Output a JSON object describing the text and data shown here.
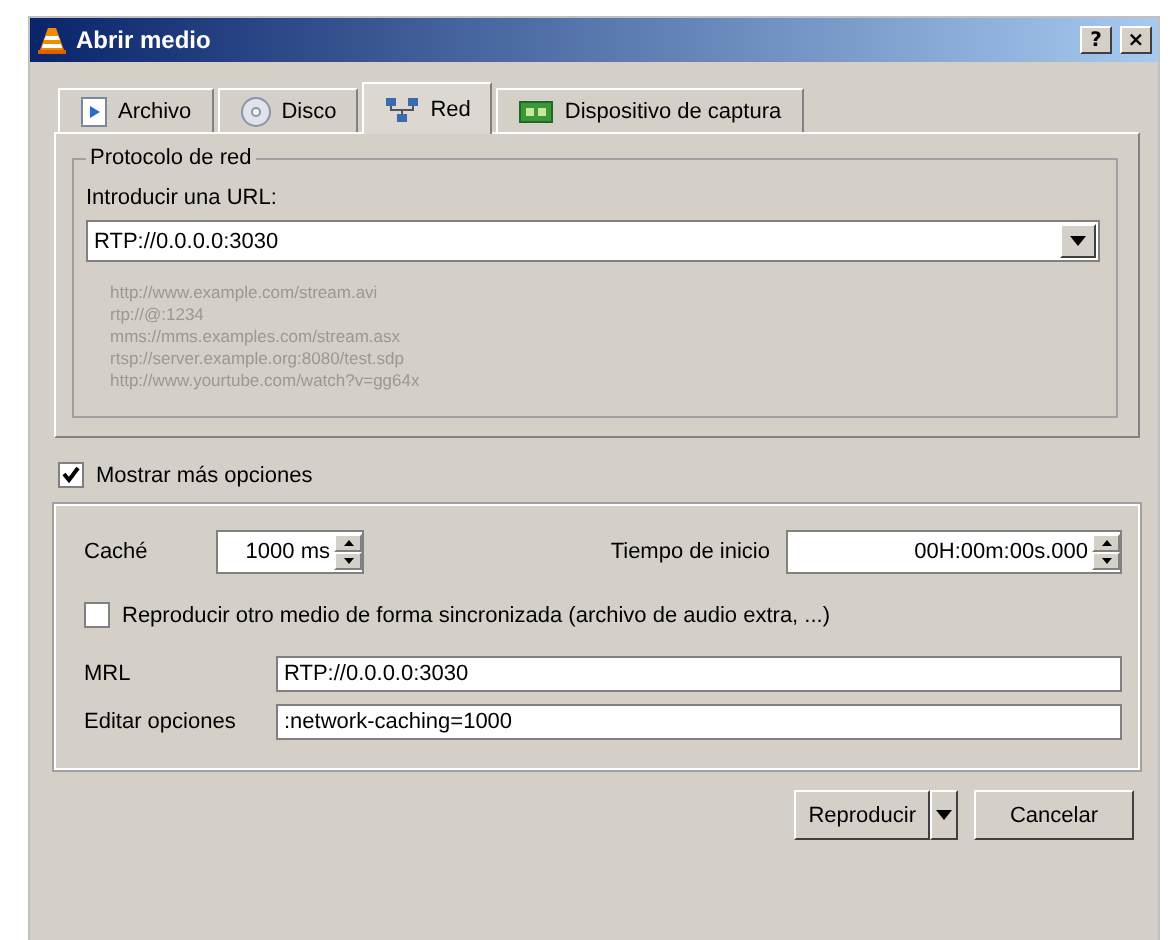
{
  "window": {
    "title": "Abrir medio",
    "help": "?",
    "close": "×"
  },
  "tabs": [
    {
      "label": "Archivo",
      "kind": "file",
      "selected": false
    },
    {
      "label": "Disco",
      "kind": "disc",
      "selected": false
    },
    {
      "label": "Red",
      "kind": "network",
      "selected": true
    },
    {
      "label": "Dispositivo de captura",
      "kind": "capture",
      "selected": false
    }
  ],
  "protocol": {
    "title": "Protocolo de red",
    "url_label": "Introducir una URL:",
    "url_value": "RTP://0.0.0.0:3030",
    "examples": [
      "http://www.example.com/stream.avi",
      "rtp://@:1234",
      "mms://mms.examples.com/stream.asx",
      "rtsp://server.example.org:8080/test.sdp",
      "http://www.yourtube.com/watch?v=gg64x"
    ]
  },
  "more_options": {
    "label": "Mostrar más opciones",
    "checked": true
  },
  "options": {
    "cache_label": "Caché",
    "cache_value": "1000 ms",
    "start_label": "Tiempo de inicio",
    "start_value": "00H:00m:00s.000",
    "sync": {
      "label": "Reproducir otro medio de forma sincronizada (archivo de audio extra, ...)",
      "checked": false
    },
    "mrl_label": "MRL",
    "mrl_value": "RTP://0.0.0.0:3030",
    "edit_label": "Editar opciones",
    "edit_value": ":network-caching=1000"
  },
  "buttons": {
    "play": "Reproducir",
    "cancel": "Cancelar"
  }
}
